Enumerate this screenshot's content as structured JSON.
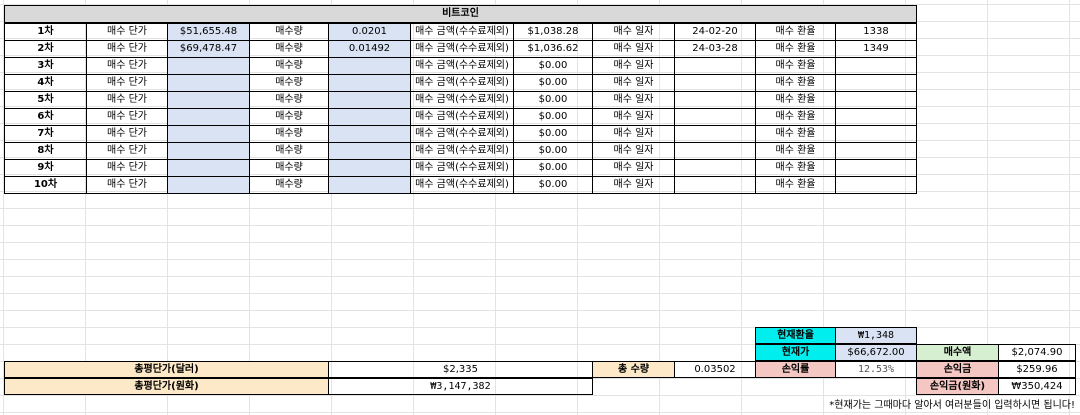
{
  "sheet": {
    "title": "비트코인",
    "labels": {
      "price": "매수 단가",
      "qty": "매수량",
      "amount": "매수 금액(수수료제외)",
      "date": "매수 일자",
      "rate": "매수 환율"
    },
    "rows": [
      {
        "n": "1차",
        "price": "$51,655.48",
        "qty": "0.0201",
        "amount": "$1,038.28",
        "date": "24-02-20",
        "rate": "1338"
      },
      {
        "n": "2차",
        "price": "$69,478.47",
        "qty": "0.01492",
        "amount": "$1,036.62",
        "date": "24-03-28",
        "rate": "1349"
      },
      {
        "n": "3차",
        "price": "",
        "qty": "",
        "amount": "$0.00",
        "date": "",
        "rate": ""
      },
      {
        "n": "4차",
        "price": "",
        "qty": "",
        "amount": "$0.00",
        "date": "",
        "rate": ""
      },
      {
        "n": "5차",
        "price": "",
        "qty": "",
        "amount": "$0.00",
        "date": "",
        "rate": ""
      },
      {
        "n": "6차",
        "price": "",
        "qty": "",
        "amount": "$0.00",
        "date": "",
        "rate": ""
      },
      {
        "n": "7차",
        "price": "",
        "qty": "",
        "amount": "$0.00",
        "date": "",
        "rate": ""
      },
      {
        "n": "8차",
        "price": "",
        "qty": "",
        "amount": "$0.00",
        "date": "",
        "rate": ""
      },
      {
        "n": "9차",
        "price": "",
        "qty": "",
        "amount": "$0.00",
        "date": "",
        "rate": ""
      },
      {
        "n": "10차",
        "price": "",
        "qty": "",
        "amount": "$0.00",
        "date": "",
        "rate": ""
      }
    ]
  },
  "summary": {
    "current_rate_label": "현재환율",
    "current_rate_value": "₩1,348",
    "current_price_label": "현재가",
    "current_price_value": "$66,672.00",
    "buy_amount_label": "매수액",
    "buy_amount_value": "$2,074.90",
    "avg_usd_label": "총평단가(달러)",
    "avg_usd_value": "$2,335",
    "total_qty_label": "총 수량",
    "total_qty_value": "0.03502",
    "pl_rate_label": "손익률",
    "pl_rate_value": "12.53%",
    "pl_label": "손익금",
    "pl_value": "$259.96",
    "avg_krw_label": "총평단가(원화)",
    "avg_krw_value": "₩3,147,382",
    "pl_krw_label": "손익금(원화)",
    "pl_krw_value": "₩350,424",
    "note": "*현재가는 그때마다 알아서 여러분들이 입력하시면 됩니다!"
  },
  "colors": {
    "title_bg": "#d9d9d9",
    "input_blue": "#dae3f3",
    "cyan": "#00eeee",
    "pink": "#f4c7c3",
    "peach": "#fde9c7",
    "green": "#d6efd0"
  }
}
